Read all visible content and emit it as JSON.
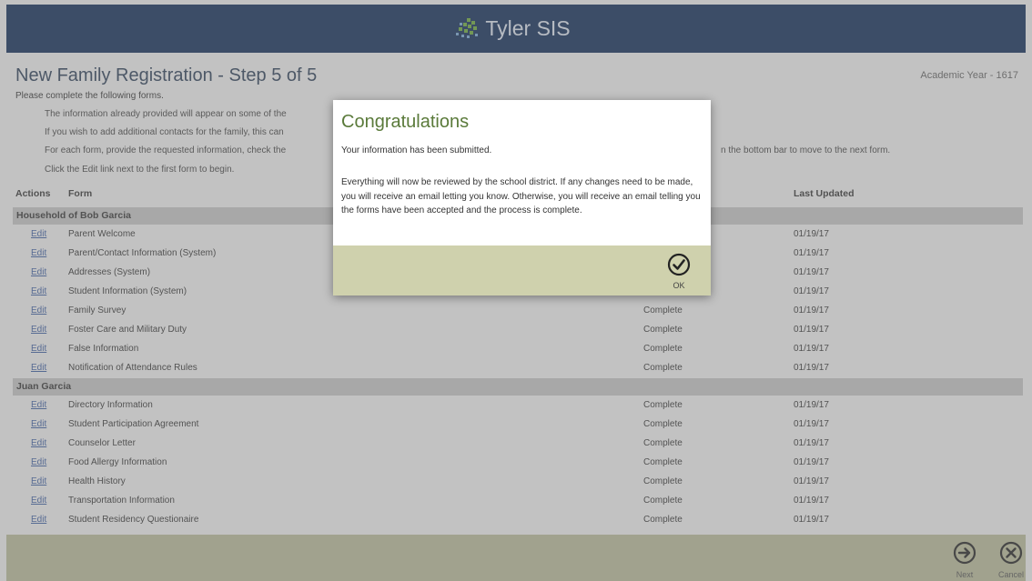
{
  "brand": {
    "name": "Tyler SIS"
  },
  "page": {
    "title": "New Family Registration - Step 5 of 5",
    "academic_year": "Academic Year - 1617",
    "instructions": [
      "Please complete the following forms.",
      "The information already provided will appear on some of the",
      "If you wish to add additional contacts for the family, this can",
      "For each form, provide the requested information, check the",
      "Click the Edit link next to the first form to begin."
    ],
    "instruction_tail": "n the bottom bar to move to the next form."
  },
  "table": {
    "headers": {
      "actions": "Actions",
      "form": "Form",
      "last_updated": "Last Updated"
    },
    "groups": [
      {
        "name": "Household of Bob Garcia",
        "rows": [
          {
            "edit": "Edit",
            "form": "Parent Welcome",
            "status": "",
            "date": "01/19/17"
          },
          {
            "edit": "Edit",
            "form": "Parent/Contact Information (System)",
            "status": "",
            "date": "01/19/17"
          },
          {
            "edit": "Edit",
            "form": "Addresses (System)",
            "status": "",
            "date": "01/19/17"
          },
          {
            "edit": "Edit",
            "form": "Student Information (System)",
            "status": "",
            "date": "01/19/17"
          },
          {
            "edit": "Edit",
            "form": "Family Survey",
            "status": "Complete",
            "date": "01/19/17"
          },
          {
            "edit": "Edit",
            "form": "Foster Care and Military Duty",
            "status": "Complete",
            "date": "01/19/17"
          },
          {
            "edit": "Edit",
            "form": "False Information",
            "status": "Complete",
            "date": "01/19/17"
          },
          {
            "edit": "Edit",
            "form": "Notification of Attendance Rules",
            "status": "Complete",
            "date": "01/19/17"
          }
        ]
      },
      {
        "name": "Juan Garcia",
        "rows": [
          {
            "edit": "Edit",
            "form": "Directory Information",
            "status": "Complete",
            "date": "01/19/17"
          },
          {
            "edit": "Edit",
            "form": "Student Participation Agreement",
            "status": "Complete",
            "date": "01/19/17"
          },
          {
            "edit": "Edit",
            "form": "Counselor Letter",
            "status": "Complete",
            "date": "01/19/17"
          },
          {
            "edit": "Edit",
            "form": "Food Allergy Information",
            "status": "Complete",
            "date": "01/19/17"
          },
          {
            "edit": "Edit",
            "form": "Health History",
            "status": "Complete",
            "date": "01/19/17"
          },
          {
            "edit": "Edit",
            "form": "Transportation Information",
            "status": "Complete",
            "date": "01/19/17"
          },
          {
            "edit": "Edit",
            "form": "Student Residency Questionaire",
            "status": "Complete",
            "date": "01/19/17"
          }
        ]
      }
    ]
  },
  "dialog": {
    "title": "Congratulations",
    "line1": "Your information has been submitted.",
    "line2": "Everything will now be reviewed by the school district. If any changes need to be made, you will receive an email letting you know. Otherwise, you will receive an email telling you the forms have been accepted and the process is complete.",
    "ok_label": "OK",
    "ok_icon": "check-circle-icon"
  },
  "bottom_bar": {
    "next_label": "Next",
    "cancel_label": "Cancel",
    "next_icon": "arrow-right-circle-icon",
    "cancel_icon": "x-circle-icon"
  },
  "colors": {
    "header_bg": "#0c2a5a",
    "bottom_bar": "#c3c5a0",
    "dialog_title": "#5a7a3a",
    "link": "#3a5fa8"
  }
}
